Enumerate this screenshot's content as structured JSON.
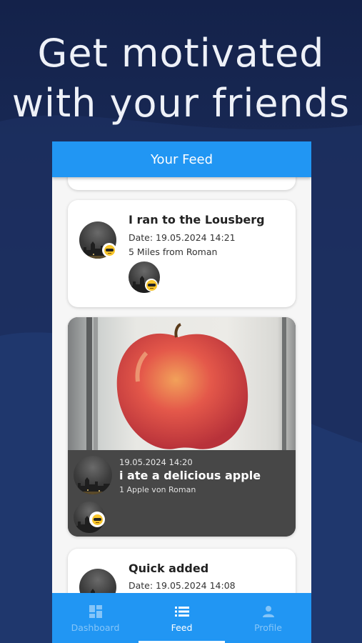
{
  "promo": {
    "headline_line1": "Get motivated",
    "headline_line2": "with your friends"
  },
  "app": {
    "appbar_title": "Your Feed",
    "colors": {
      "primary": "#2196f3",
      "background": "#1b2d5c",
      "card_dark": "#474747"
    }
  },
  "feed": {
    "items": [
      {
        "title": "I ran to the Lousberg",
        "date": "Date: 19.05.2024 14:21",
        "detail": "5 Miles from Roman",
        "avatar_icon": "user-avatar-icon",
        "badge_icon": "sunglasses-emoji-icon"
      },
      {
        "title": "i ate a delicious apple",
        "date": "19.05.2024 14:20",
        "detail": "1 Apple von Roman",
        "image": "apple-photo",
        "badge_icon": "sunglasses-emoji-icon"
      },
      {
        "title": "Quick added",
        "date": "Date: 19.05.2024 14:08"
      }
    ]
  },
  "bottom_nav": {
    "items": [
      {
        "label": "Dashboard",
        "icon": "dashboard-icon",
        "active": false
      },
      {
        "label": "Feed",
        "icon": "list-icon",
        "active": true
      },
      {
        "label": "Profile",
        "icon": "person-icon",
        "active": false
      }
    ]
  }
}
